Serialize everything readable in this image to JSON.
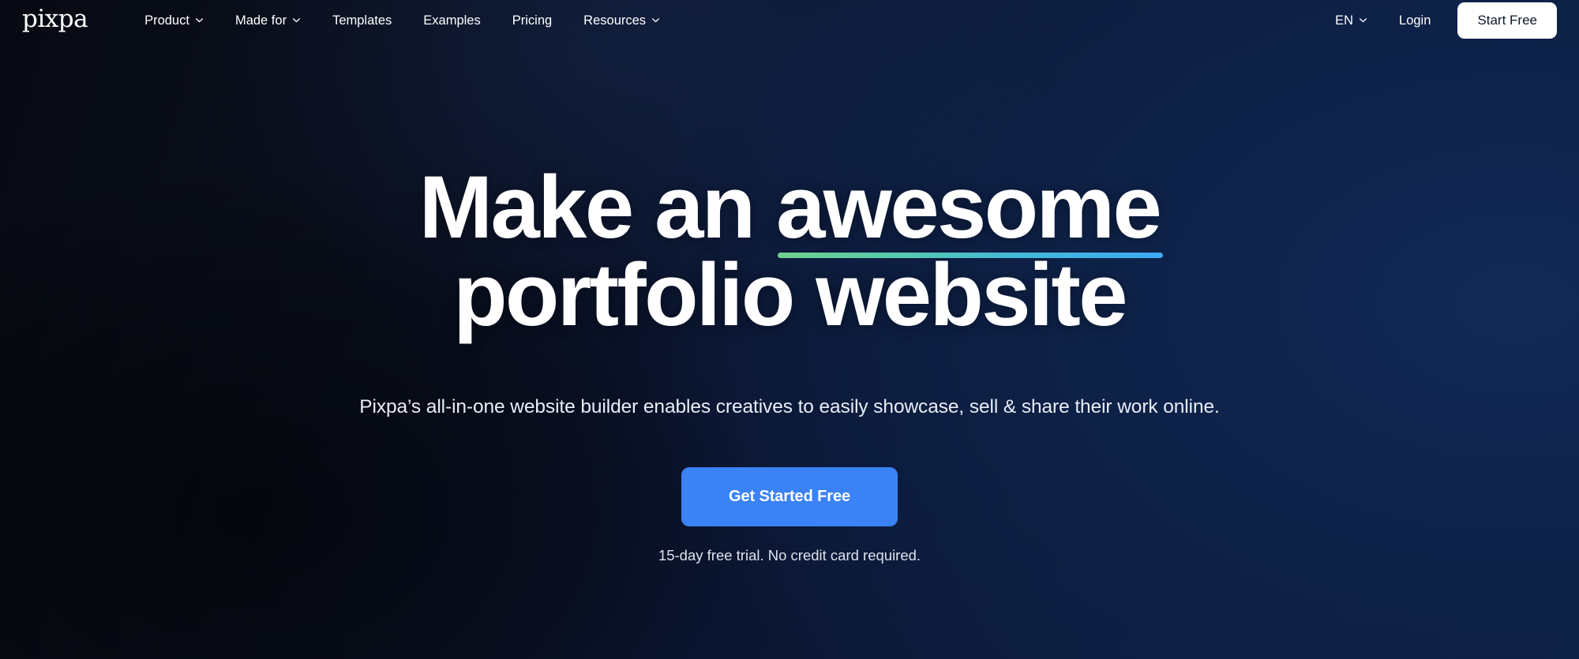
{
  "brand": {
    "logo_text": "pixpa"
  },
  "header": {
    "nav_items": [
      {
        "label": "Product",
        "has_dropdown": true,
        "icon": "chevron-down-icon"
      },
      {
        "label": "Made for",
        "has_dropdown": true,
        "icon": "chevron-down-icon"
      },
      {
        "label": "Templates",
        "has_dropdown": false,
        "icon": ""
      },
      {
        "label": "Examples",
        "has_dropdown": false,
        "icon": ""
      },
      {
        "label": "Pricing",
        "has_dropdown": false,
        "icon": ""
      },
      {
        "label": "Resources",
        "has_dropdown": true,
        "icon": "chevron-down-icon"
      }
    ],
    "language": {
      "label": "EN",
      "icon": "chevron-down-icon"
    },
    "login_label": "Login",
    "start_free_label": "Start Free"
  },
  "hero": {
    "headline_part1": "Make an ",
    "headline_highlight": "awesome",
    "headline_part2": "portfolio website",
    "subtitle": "Pixpa’s all-in-one website builder enables creatives to easily showcase, sell & share their work online.",
    "cta_label": "Get Started Free",
    "trial_note": "15-day free trial. No credit card required."
  },
  "colors": {
    "background_dark": "#070A12",
    "background_navy": "#0D2048",
    "cta_blue": "#3B82F6",
    "start_free_bg": "#FFFFFF",
    "start_free_text": "#101828",
    "underline_green": "#6FD18C",
    "underline_blue": "#3FA9F5",
    "text_primary": "#FFFFFF",
    "text_secondary": "#E8EDF6"
  }
}
